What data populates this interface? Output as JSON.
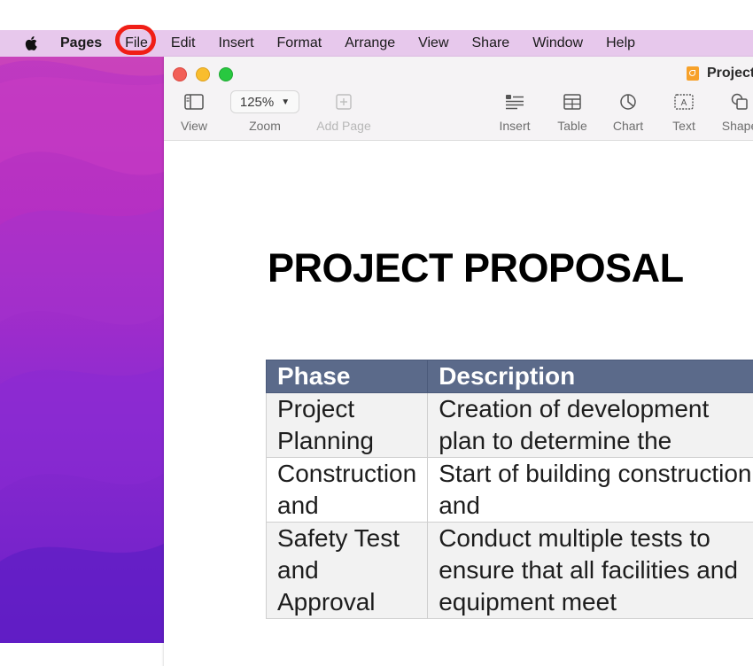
{
  "menubar": {
    "app_name": "Pages",
    "items": [
      "File",
      "Edit",
      "Insert",
      "Format",
      "Arrange",
      "View",
      "Share",
      "Window",
      "Help"
    ]
  },
  "window": {
    "title": "Project",
    "toolbar": {
      "view_label": "View",
      "zoom_value": "125%",
      "zoom_label": "Zoom",
      "add_page_label": "Add Page",
      "insert_label": "Insert",
      "table_label": "Table",
      "chart_label": "Chart",
      "text_label": "Text",
      "shape_label": "Shape"
    }
  },
  "document": {
    "heading": "PROJECT PROPOSAL",
    "table": {
      "headers": [
        "Phase",
        "Description"
      ],
      "rows": [
        [
          "Project Planning",
          "Creation of development plan to determine the"
        ],
        [
          "Construction and",
          "Start of building construction and"
        ],
        [
          "Safety Test and Approval",
          "Conduct multiple tests to ensure that all facilities and equipment meet"
        ]
      ]
    }
  },
  "colors": {
    "menubar_bg": "#e7c8ec",
    "table_header_bg": "#5b6a8a",
    "highlight_ring": "#f01e16"
  }
}
